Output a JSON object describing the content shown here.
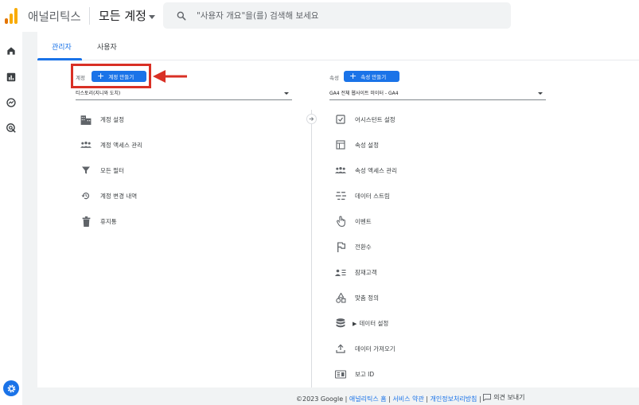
{
  "header": {
    "app_title": "애널리틱스",
    "account_picker": "모든 계정",
    "search_placeholder": "\"사용자 개요\"을(를) 검색해 보세요"
  },
  "colors": {
    "accent": "#1a73e8",
    "highlight": "#d93025",
    "logo_orange": "#f9ab00",
    "logo_dark": "#e37400"
  },
  "rail": {
    "icons": [
      "home-icon",
      "reports-icon",
      "explore-icon",
      "advertising-icon",
      "admin-gear-icon"
    ]
  },
  "tabs": [
    {
      "label": "관리자",
      "active": true
    },
    {
      "label": "사용자",
      "active": false
    }
  ],
  "account_column": {
    "label": "계정",
    "create_button": "계정 만들기",
    "selected": "티스토리(지니와 도치)",
    "items": [
      {
        "label": "계정 설정",
        "icon": "building-icon"
      },
      {
        "label": "계정 액세스 관리",
        "icon": "people-icon"
      },
      {
        "label": "모든 필터",
        "icon": "filter-icon"
      },
      {
        "label": "계정 변경 내역",
        "icon": "history-icon"
      },
      {
        "label": "휴지통",
        "icon": "trash-icon"
      }
    ]
  },
  "property_column": {
    "label": "속성",
    "create_button": "속성 만들기",
    "selected": "GA4 전체 웹사이트 미이터 - GA4",
    "items": [
      {
        "label": "어시스턴트 설정",
        "icon": "checklist-icon"
      },
      {
        "label": "속성 설정",
        "icon": "property-settings-icon"
      },
      {
        "label": "속성 액세스 관리",
        "icon": "people-icon"
      },
      {
        "label": "데이터 스트림",
        "icon": "data-stream-icon"
      },
      {
        "label": "이벤트",
        "icon": "touch-icon"
      },
      {
        "label": "전환수",
        "icon": "flag-icon"
      },
      {
        "label": "잠재고객",
        "icon": "audience-icon"
      },
      {
        "label": "맞춤 정의",
        "icon": "shapes-icon"
      },
      {
        "label": "데이터 설정",
        "icon": "database-icon"
      },
      {
        "label": "데이터 가져오기",
        "icon": "upload-icon"
      },
      {
        "label": "보고 ID",
        "icon": "id-icon"
      }
    ]
  },
  "footer": {
    "copyright": "©2023 Google",
    "links": [
      "애널리틱스 홈",
      "서비스 약관",
      "개인정보처리방침"
    ],
    "feedback": "의견 보내기"
  }
}
